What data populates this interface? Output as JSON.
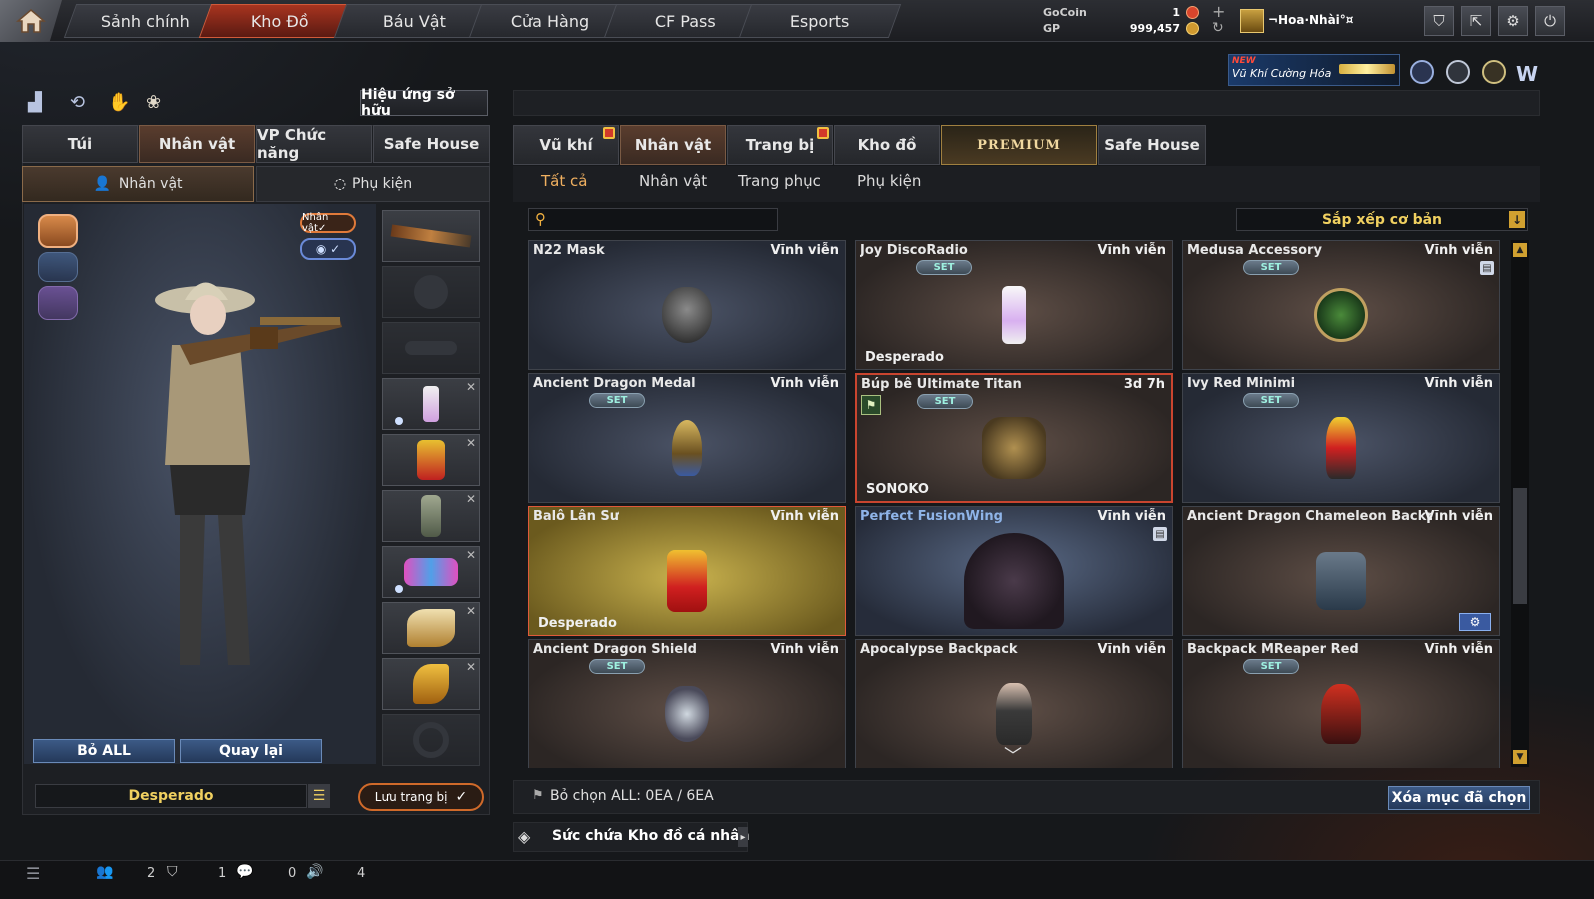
{
  "nav": {
    "tabs": [
      "Sảnh chính",
      "Kho Đồ",
      "Báu Vật",
      "Cửa Hàng",
      "CF Pass",
      "Esports"
    ],
    "active": "Kho Đồ"
  },
  "currency": {
    "gocoin_label": "GoCoin",
    "gp_label": "GP",
    "gocoin_value": "1",
    "gp_value": "999,457"
  },
  "user": {
    "name": "¬Hoa·Nhài°¤"
  },
  "promo": {
    "new": "NEW",
    "text": "Vũ Khí Cường Hóa"
  },
  "left": {
    "owned_effects": "Hiệu ứng sở hữu",
    "tabs": [
      "Túi",
      "Nhân vật",
      "VP Chức năng",
      "Safe House"
    ],
    "subtabs": [
      "Nhân vật",
      "Phụ kiện"
    ],
    "char_badge": "Nhân vật✓",
    "remove_all": "Bỏ ALL",
    "back": "Quay lại",
    "preset_name": "Desperado",
    "save": "Lưu trang bị"
  },
  "right": {
    "tabs": [
      "Vũ khí",
      "Nhân vật",
      "Trang bị",
      "Kho đồ",
      "PREMIUM",
      "Safe House"
    ],
    "filters": [
      "Tất cả",
      "Nhân vật",
      "Trang phục",
      "Phụ kiện"
    ],
    "search_placeholder": "",
    "sort": "Sắp xếp cơ bản",
    "items": [
      {
        "name": "N22 Mask",
        "duration": "Vĩnh viễn",
        "set": "",
        "footer": "",
        "icon": "mask-icon"
      },
      {
        "name": "Joy DiscoRadio",
        "duration": "Vĩnh viễn",
        "set": "SET",
        "footer": "Desperado",
        "icon": "radio-icon"
      },
      {
        "name": "Medusa Accessory",
        "duration": "Vĩnh viễn",
        "set": "SET",
        "footer": "",
        "icon": "medallion-icon"
      },
      {
        "name": "Ancient Dragon Medal",
        "duration": "Vĩnh viễn",
        "set": "SET",
        "footer": "",
        "icon": "medal-icon"
      },
      {
        "name": "Búp bê Ultimate Titan",
        "duration": "3d 7h",
        "set": "SET",
        "footer": "SONOKO",
        "icon": "titan-doll-icon"
      },
      {
        "name": "Ivy Red Minimi",
        "duration": "Vĩnh viễn",
        "set": "SET",
        "footer": "",
        "icon": "minimi-doll-icon"
      },
      {
        "name": "Balô Lân Sư",
        "duration": "Vĩnh viễn",
        "set": "",
        "footer": "Desperado",
        "icon": "lion-backpack-icon"
      },
      {
        "name": "Perfect FusionWing",
        "duration": "Vĩnh viễn",
        "set": "",
        "footer": "",
        "icon": "wings-icon"
      },
      {
        "name": "Ancient Dragon Chameleon Backpack",
        "duration": "Vĩnh viễn",
        "set": "",
        "footer": "",
        "icon": "backpack-icon"
      },
      {
        "name": "Ancient Dragon Shield",
        "duration": "Vĩnh viễn",
        "set": "SET",
        "footer": "",
        "icon": "shield-icon"
      },
      {
        "name": "Apocalypse Backpack",
        "duration": "Vĩnh viễn",
        "set": "",
        "footer": "",
        "icon": "doll-icon"
      },
      {
        "name": "Backpack MReaper Red",
        "duration": "Vĩnh viễn",
        "set": "SET",
        "footer": "",
        "icon": "reaper-icon"
      }
    ],
    "deselect": "Bỏ chọn ALL: 0EA / 6EA",
    "delete": "Xóa mục đã chọn",
    "capacity": "Sức chứa Kho đồ cá nhân"
  },
  "statusbar": {
    "friends": "2",
    "clan": "1",
    "chat": "0",
    "voice": "4"
  }
}
